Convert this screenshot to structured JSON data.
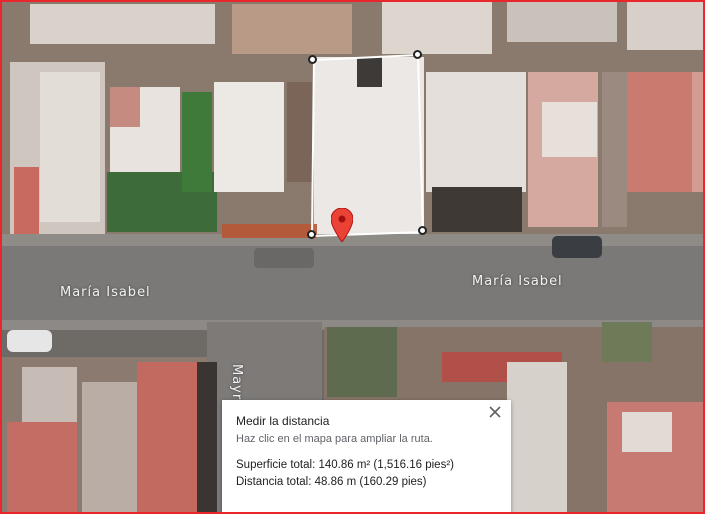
{
  "map": {
    "streets": {
      "label_left": "María Isabel",
      "label_right": "María Isabel",
      "label_vertical": "Mayra"
    },
    "pin_color": "#ea4335",
    "measure_vertices": 4
  },
  "measure": {
    "title": "Medir la distancia",
    "hint": "Haz clic en el mapa para ampliar la ruta.",
    "area": "Superficie total: 140.86 m² (1,516.16 pies²)",
    "distance": "Distancia total: 48.86 m (160.29 pies)",
    "close_icon": "close-icon"
  },
  "colors": {
    "border": "#e8262b",
    "road": "#7b7977",
    "roof_light": "#e9e4df"
  }
}
